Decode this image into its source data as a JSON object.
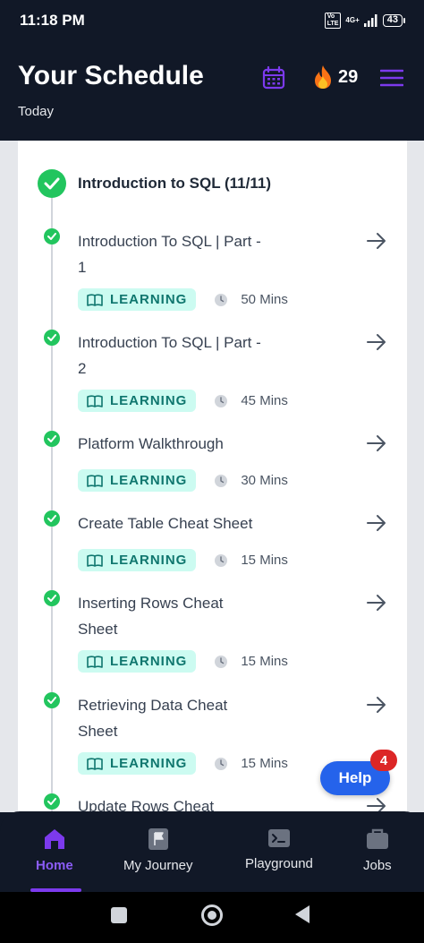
{
  "status_bar": {
    "time": "11:18 PM",
    "volte": "VoLTE",
    "network": "4G+",
    "battery": "43"
  },
  "header": {
    "title": "Your Schedule",
    "subtitle": "Today",
    "streak_count": "29"
  },
  "module": {
    "title": "Introduction to SQL (11/11)"
  },
  "items": [
    {
      "title": "Introduction To SQL | Part - 1",
      "tag": "LEARNING",
      "duration": "50 Mins"
    },
    {
      "title": "Introduction To SQL | Part - 2",
      "tag": "LEARNING",
      "duration": "45 Mins"
    },
    {
      "title": "Platform Walkthrough",
      "tag": "LEARNING",
      "duration": "30 Mins"
    },
    {
      "title": "Create Table Cheat Sheet",
      "tag": "LEARNING",
      "duration": "15 Mins"
    },
    {
      "title": "Inserting Rows Cheat Sheet",
      "tag": "LEARNING",
      "duration": "15 Mins"
    },
    {
      "title": "Retrieving Data Cheat Sheet",
      "tag": "LEARNING",
      "duration": "15 Mins"
    },
    {
      "title": "Update Rows Cheat"
    }
  ],
  "help": {
    "label": "Help",
    "badge": "4"
  },
  "nav": {
    "home": "Home",
    "journey": "My Journey",
    "playground": "Playground",
    "jobs": "Jobs"
  },
  "colors": {
    "accent": "#7c3aed",
    "success": "#22c55e",
    "tag_bg": "#ccfbf1",
    "tag_text": "#0f766e",
    "help": "#2563eb"
  }
}
